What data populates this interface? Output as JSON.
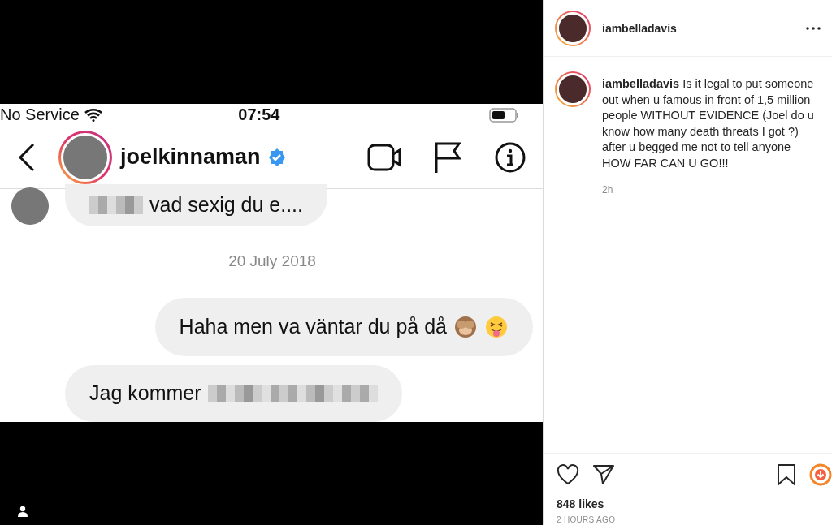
{
  "media": {
    "status_bar": {
      "carrier": "No Service",
      "time": "07:54"
    },
    "chat_header": {
      "username": "joelkinnaman",
      "verified": true
    },
    "messages": [
      {
        "kind": "received",
        "text": "vad sexig du e....",
        "redacted_prefix": true,
        "redacted_suffix": false,
        "show_avatar": true
      },
      {
        "kind": "date",
        "text": "20 July 2018"
      },
      {
        "kind": "sent",
        "text": "Haha men va väntar du på då",
        "emoji": true
      },
      {
        "kind": "received",
        "text": "Jag kommer",
        "redacted_prefix": false,
        "redacted_suffix": true,
        "show_avatar": false
      }
    ]
  },
  "post": {
    "author": "iambelladavis",
    "caption": {
      "author": "iambelladavis",
      "text": "Is it legal to put someone out when u famous in front of 1,5 million people WITHOUT EVIDENCE (Joel do u know how many death threats I got ?) after u begged me not to tell anyone HOW FAR CAN U GO!!!"
    },
    "time": "2h",
    "likes": "848 likes",
    "date": "2 HOURS AGO"
  }
}
